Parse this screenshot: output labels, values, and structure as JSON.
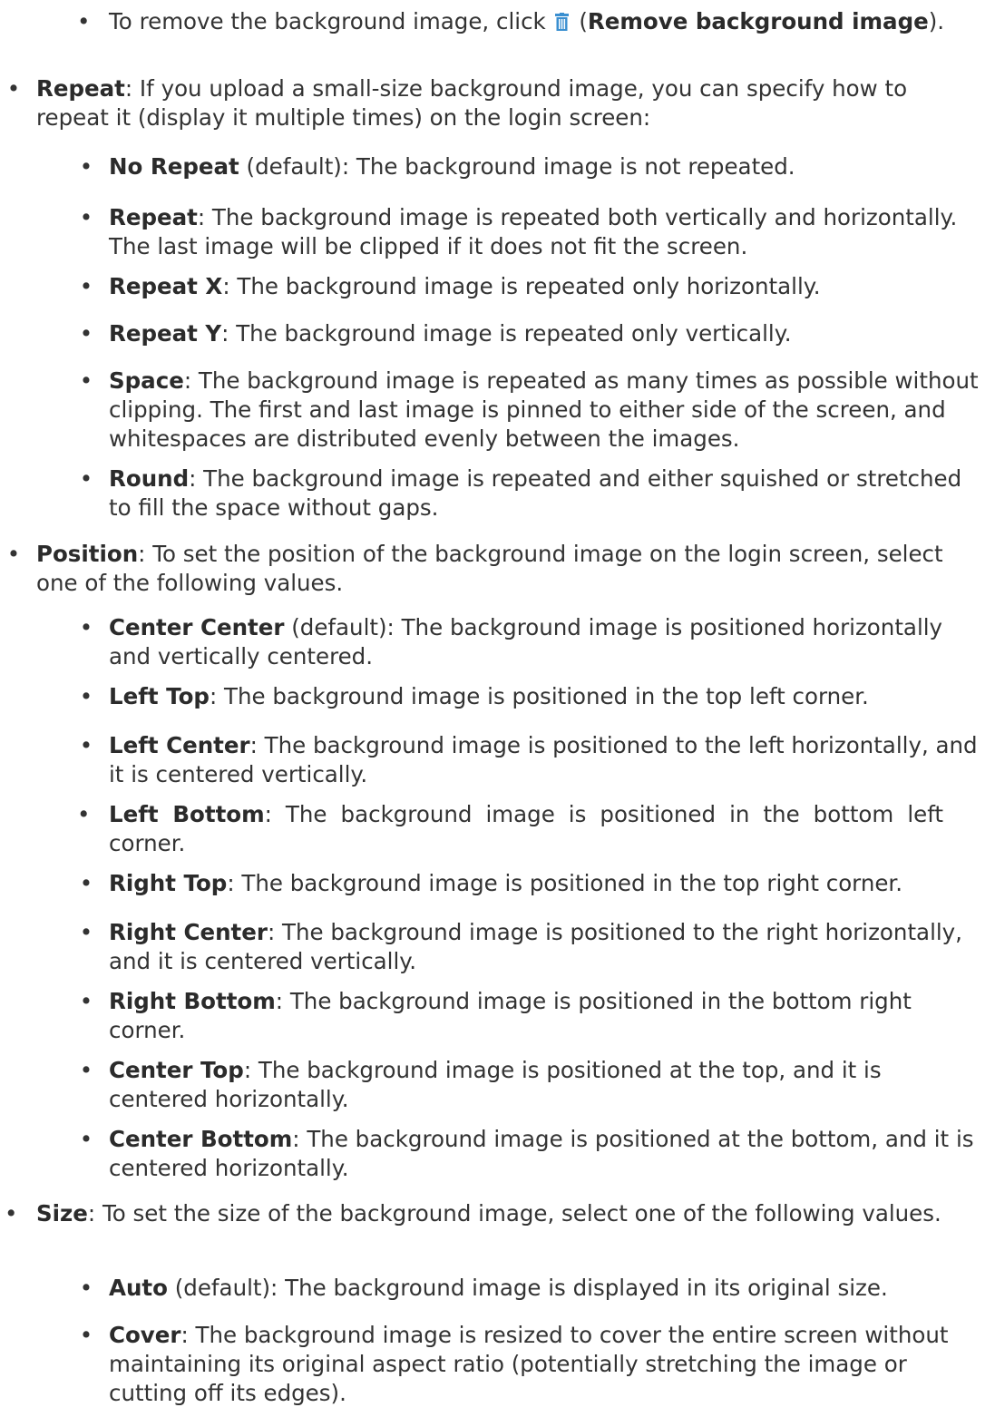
{
  "icons": {
    "remove_bg": "trash-icon",
    "color": "#3a8fd0"
  },
  "remove_line": {
    "pre": "To remove the background image, click ",
    "open_paren": "(",
    "bold": "Remove background image",
    "close": ")."
  },
  "repeat": {
    "term": "Repeat",
    "desc": ": If you upload a small-size background image, you can specify how to repeat it (display it multiple times) on the login screen:",
    "options": [
      {
        "term": "No Repeat",
        "desc": " (default): The background image is not repeated."
      },
      {
        "term": "Repeat",
        "desc": ": The background image is repeated both vertically and horizontally. The last image will be clipped if it does not fit the screen."
      },
      {
        "term": "Repeat X",
        "desc": ": The background image is repeated only horizontally."
      },
      {
        "term": "Repeat Y",
        "desc": ": The background image is repeated only vertically."
      },
      {
        "term": "Space",
        "desc": ": The background image is repeated as many times as possible without clipping. The first and last image is pinned to either side of the screen, and whitespaces are distributed evenly between the images."
      },
      {
        "term": "Round",
        "desc": ": The background image is repeated and either squished or stretched to fill the space without gaps."
      }
    ]
  },
  "position": {
    "term": "Position",
    "desc": ": To set the position of the background image on the login screen, select one of the following values.",
    "options": [
      {
        "term": "Center Center",
        "desc": " (default): The background image is positioned horizontally and vertically centered."
      },
      {
        "term": "Left Top",
        "desc": ": The background image is positioned in the top left corner."
      },
      {
        "term": "Left Center",
        "desc": ": The background image is positioned to the left horizontally, and it is centered vertically."
      },
      {
        "term": "Left Bottom",
        "desc": ": The background image is positioned in the bottom left corner."
      },
      {
        "term": "Right Top",
        "desc": ": The background image is positioned in the top right corner."
      },
      {
        "term": "Right Center",
        "desc": ": The background image is positioned to the right horizontally, and it is centered vertically."
      },
      {
        "term": "Right Bottom",
        "desc": ": The background image is positioned in the bottom right corner."
      },
      {
        "term": "Center Top",
        "desc": ": The background image is positioned at the top, and it is centered horizontally."
      },
      {
        "term": "Center Bottom",
        "desc": ": The background image is positioned at the bottom, and it is centered horizontally."
      }
    ]
  },
  "size": {
    "term": "Size",
    "desc": ": To set the size of the background image, select one of the following values.",
    "options": [
      {
        "term": "Auto",
        "desc": " (default): The background image is displayed in its original size."
      },
      {
        "term": "Cover",
        "desc": ": The background image is resized to cover the entire screen without maintaining its original aspect ratio (potentially stretching the image or cutting off its edges)."
      }
    ]
  }
}
